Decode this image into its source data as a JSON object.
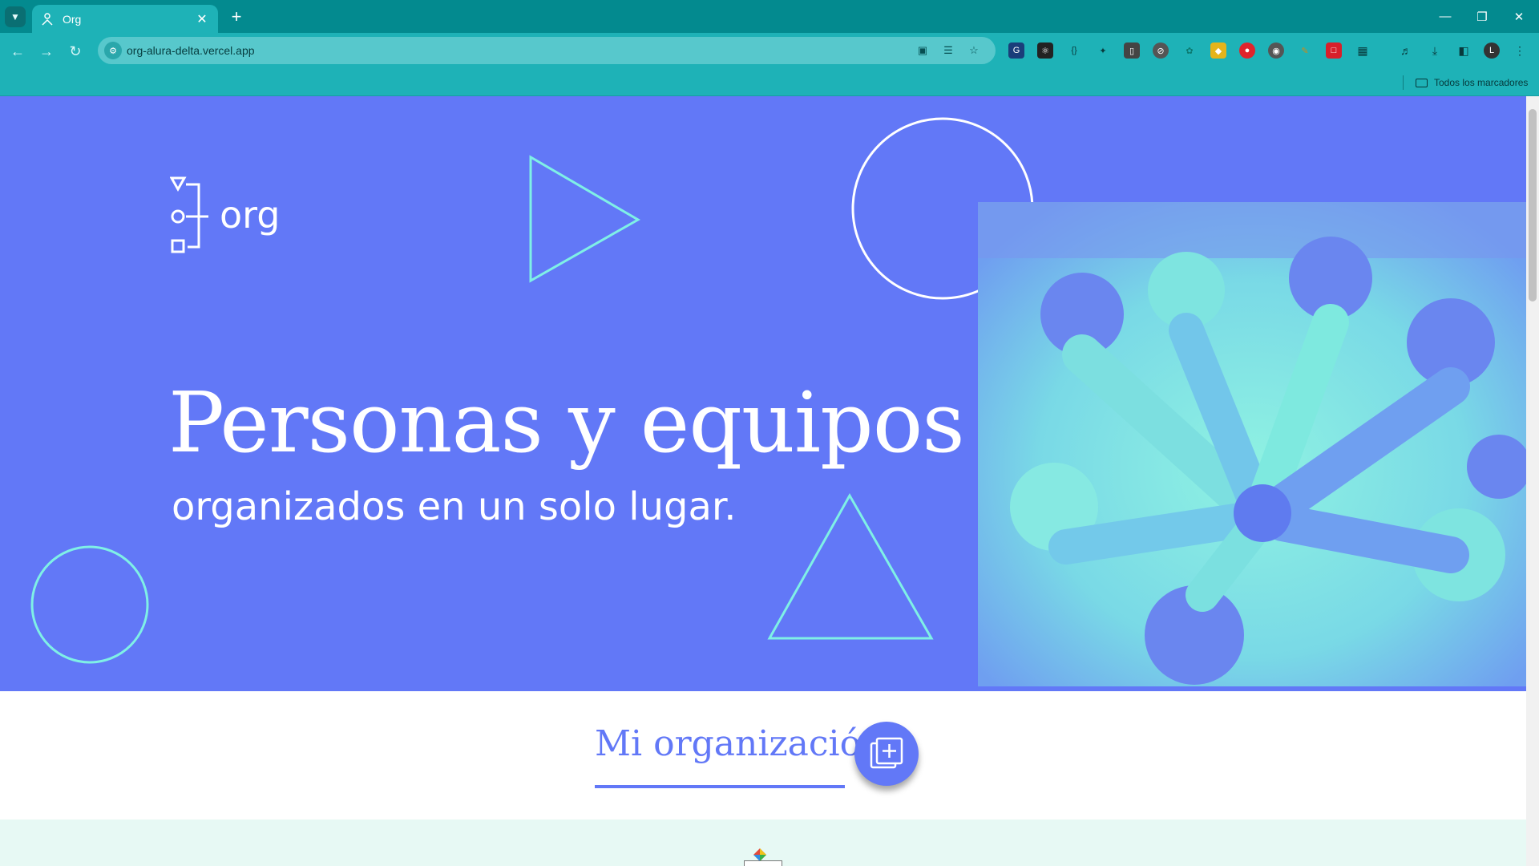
{
  "browser": {
    "tab_title": "Org",
    "url": "org-alura-delta.vercel.app",
    "bookmarks_all": "Todos los marcadores",
    "profile_initial": "L"
  },
  "hero": {
    "logo_text": "org",
    "title": "Personas y equipos",
    "subtitle": "organizados en un solo lugar."
  },
  "section": {
    "title": "Mi organización"
  },
  "colors": {
    "chrome_dark": "#038a8f",
    "chrome": "#1eb2b7",
    "hero_bg": "#6278f7",
    "accent_cyan": "#7ff0e6",
    "lower_bg": "#e7f9f4"
  }
}
